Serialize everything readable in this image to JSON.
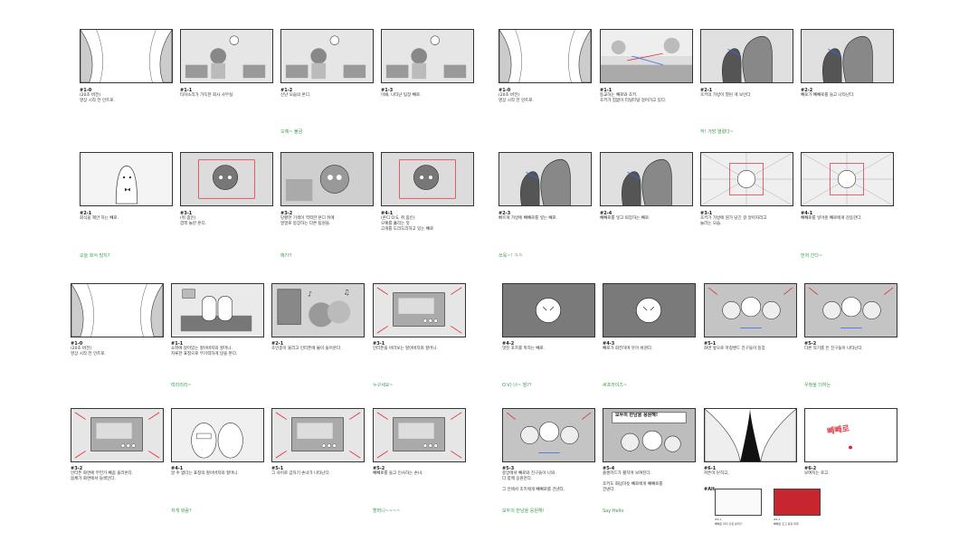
{
  "colors": {
    "dialogue": "#3a9a4a",
    "border": "#333333",
    "accent_red": "#e0242e"
  },
  "q1": [
    {
      "code": "#1-0",
      "desc": "(20초 버전)\n영상 시작 전 인트로.",
      "dialogue": "",
      "art": "curtain"
    },
    {
      "code": "#1-1",
      "desc": "타자소리가 가득한 회사 사무실.",
      "dialogue": "",
      "art": "office"
    },
    {
      "code": "#1-2",
      "desc": "신난 모습의 온디.",
      "dialogue": "오예~ 불금",
      "art": "office"
    },
    {
      "code": "#1-3",
      "desc": "이때, 나타난 팀장 빼로.",
      "dialogue": "",
      "art": "office"
    },
    {
      "code": "#2-1",
      "desc": "회식을 제안 하는 빼로.",
      "dialogue": "오늘 회식 많지?",
      "art": "ghost"
    },
    {
      "code": "#3-1",
      "desc": "(쥐 줌인)\n깜짝 놀란 온디.",
      "dialogue": "",
      "art": "face"
    },
    {
      "code": "#3-2",
      "desc": "당황한 기색이 역력한 온디 뒤에\n얼얼로 등장하는 다른 팀원들.",
      "dialogue": "예???",
      "art": "crowd"
    },
    {
      "code": "#4-1",
      "desc": "(온디 O.S, 쥐 줌인)\n오예를 흘리는 듯\n고개를 도리도리하고 있는 빼로",
      "dialogue": "",
      "art": "face"
    }
  ],
  "q2": [
    {
      "code": "#1-0",
      "desc": "(20초 버전)\n영상 시작 전 인트로.",
      "dialogue": "",
      "art": "curtain"
    },
    {
      "code": "#1-1",
      "desc": "등교하는 빼로와 초키.\n초키가 힘없이 터덜터덜 걸어가고 있다.",
      "dialogue": "",
      "art": "street"
    },
    {
      "code": "#2-1",
      "desc": "초키의 가방이 열린 게 보인다.",
      "dialogue": "허! 가방 열렸다~",
      "art": "bag"
    },
    {
      "code": "#2-2",
      "desc": "빼로가 빼빼로를 들고 나타난다.",
      "dialogue": "",
      "art": "bag"
    },
    {
      "code": "#2-3",
      "desc": "빠르게 가방에 빼빼로를 넣는 빼로.",
      "dialogue": "쏘옥~! ㅋㅋ",
      "art": "bag"
    },
    {
      "code": "#2-4",
      "desc": "빼빼로를 넣고 퇴장하는 빼로.",
      "dialogue": "",
      "art": "bag"
    },
    {
      "code": "#3-1",
      "desc": "초키가 가방에 뭔가 담긴 걸 알아차리고\n놀라는 모습.",
      "dialogue": "",
      "art": "burst"
    },
    {
      "code": "#4-1",
      "desc": "빼빼로를 넣어준 빼로에게 감동한다.",
      "dialogue": "먼저 간다~",
      "art": "burst"
    }
  ],
  "q3": [
    {
      "code": "#1-0",
      "desc": "(20초 버전)\n영상 시작 전 인트로.",
      "dialogue": "",
      "art": "curtain"
    },
    {
      "code": "#1-1",
      "desc": "소파에 앉아있는 할아버지와 할머니.\n지루한 표정으로 무기력하게 앉을 본다.",
      "dialogue": "띠리리리~",
      "art": "sofa"
    },
    {
      "code": "#2-1",
      "desc": "초인종이 울리고 인터폰에 불이 들어온다.",
      "dialogue": "",
      "art": "music"
    },
    {
      "code": "#3-1",
      "desc": "인터폰을 바라보는 할아버지와 할머니.",
      "dialogue": "누구세요~",
      "art": "screen"
    },
    {
      "code": "#3-2",
      "desc": "인터폰 화면에 무언가 빼꼼 올라온다.\n몸체가 화면에서 들썩인다.",
      "dialogue": "",
      "art": "screen"
    },
    {
      "code": "#4-1",
      "desc": "알 수 없다는 표정의 할아버지와 할머니.",
      "dialogue": "저게 뭐람?",
      "art": "couple"
    },
    {
      "code": "#5-1",
      "desc": "그 사이로 갑자기 손녀가 나타난다.",
      "dialogue": "",
      "art": "screen"
    },
    {
      "code": "#5-2",
      "desc": "빼빼로를 들고 인사하는 손녀.",
      "dialogue": "할머니~~~~",
      "art": "screen"
    }
  ],
  "q4": [
    {
      "code": "#4-2",
      "desc": "멋진 포즈를 취하는 빼로.",
      "dialogue": "O.V) 너~ 정??",
      "art": "pose"
    },
    {
      "code": "#4-3",
      "desc": "빼로가 회전하며 웃이 바뀐다.",
      "dialogue": "써프라이즈~",
      "art": "pose"
    },
    {
      "code": "#5-1",
      "desc": "화면 앞으로 마칭밴드 친구들이 등장.",
      "dialogue": "",
      "art": "band"
    },
    {
      "code": "#5-2",
      "desc": "다른 악기를 든 친구들이 나타난다.",
      "dialogue": "우정을 더하는",
      "art": "band"
    },
    {
      "code": "#5-3",
      "desc": "중앙에서 빼로와 친구들이 나와\n다 함께 응원한다.\n\n그 안에서 초키에게 빼빼로를 건넨다.",
      "dialogue": "모두의 만남을 응원해!",
      "art": "band"
    },
    {
      "code": "#5-4",
      "desc": "플랜카드가 펼치며 보여진다.\n\n초키도 화답하듯 빼로에게 빼빼로를\n건넨다.",
      "dialogue": "Say Hello",
      "art": "banner"
    },
    {
      "code": "#6-1",
      "desc": "커튼이 닫히고,",
      "dialogue": "",
      "art": "curtainblack"
    },
    {
      "code": "#6-2",
      "desc": "보여지는 로고.",
      "dialogue": "",
      "art": "logo"
    }
  ],
  "banner_text": "모두의 만남을 응원해!",
  "alt_label": "#Alt",
  "alt_items": [
    {
      "code": "#6-1",
      "desc": "빼빼로 파티 같은 분위기"
    },
    {
      "code": "#6-2",
      "desc": "빼빼로 로고 등장 화면"
    }
  ],
  "logo_text": "빼빼로"
}
